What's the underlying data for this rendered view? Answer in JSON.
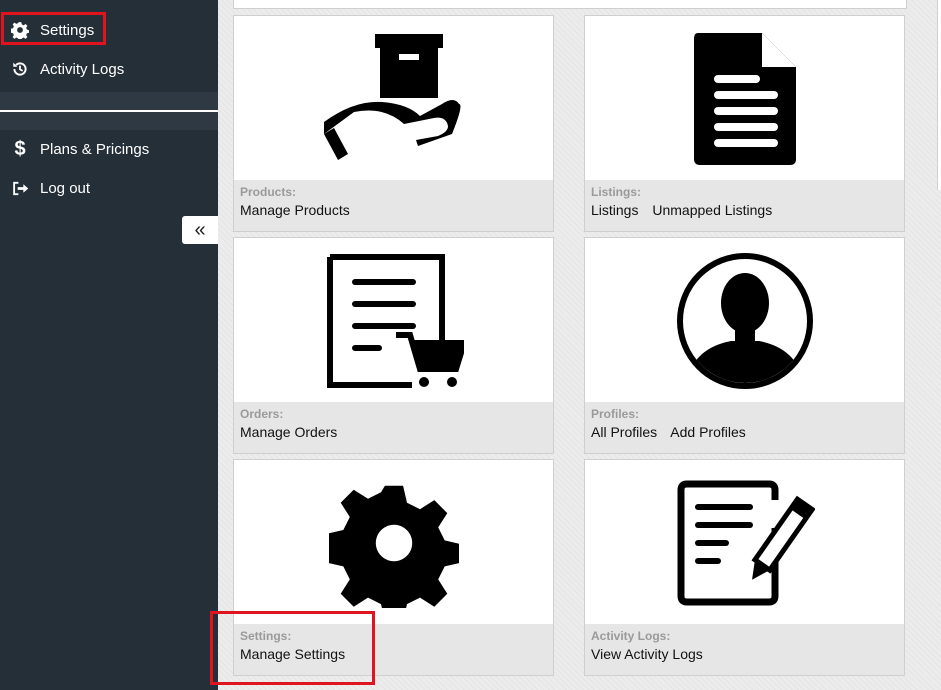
{
  "sidebar": {
    "items": [
      {
        "label": "Settings",
        "icon": "gear-icon"
      },
      {
        "label": "Activity Logs",
        "icon": "history-icon"
      },
      {
        "label": "Plans & Pricings",
        "icon": "dollar-icon"
      },
      {
        "label": "Log out",
        "icon": "logout-icon"
      }
    ],
    "collapse_glyph": "«",
    "highlight_color": "#e0141e"
  },
  "cards": [
    {
      "category": "Products:",
      "links": [
        "Manage Products"
      ],
      "icon": "hand-box-icon"
    },
    {
      "category": "Listings:",
      "links": [
        "Listings",
        "Unmapped Listings"
      ],
      "icon": "document-icon"
    },
    {
      "category": "Orders:",
      "links": [
        "Manage Orders"
      ],
      "icon": "order-cart-icon"
    },
    {
      "category": "Profiles:",
      "links": [
        "All Profiles",
        "Add Profiles"
      ],
      "icon": "user-profile-icon"
    },
    {
      "category": "Settings:",
      "links": [
        "Manage Settings"
      ],
      "icon": "gear-icon"
    },
    {
      "category": "Activity Logs:",
      "links": [
        "View Activity Logs"
      ],
      "icon": "edit-document-icon"
    }
  ]
}
